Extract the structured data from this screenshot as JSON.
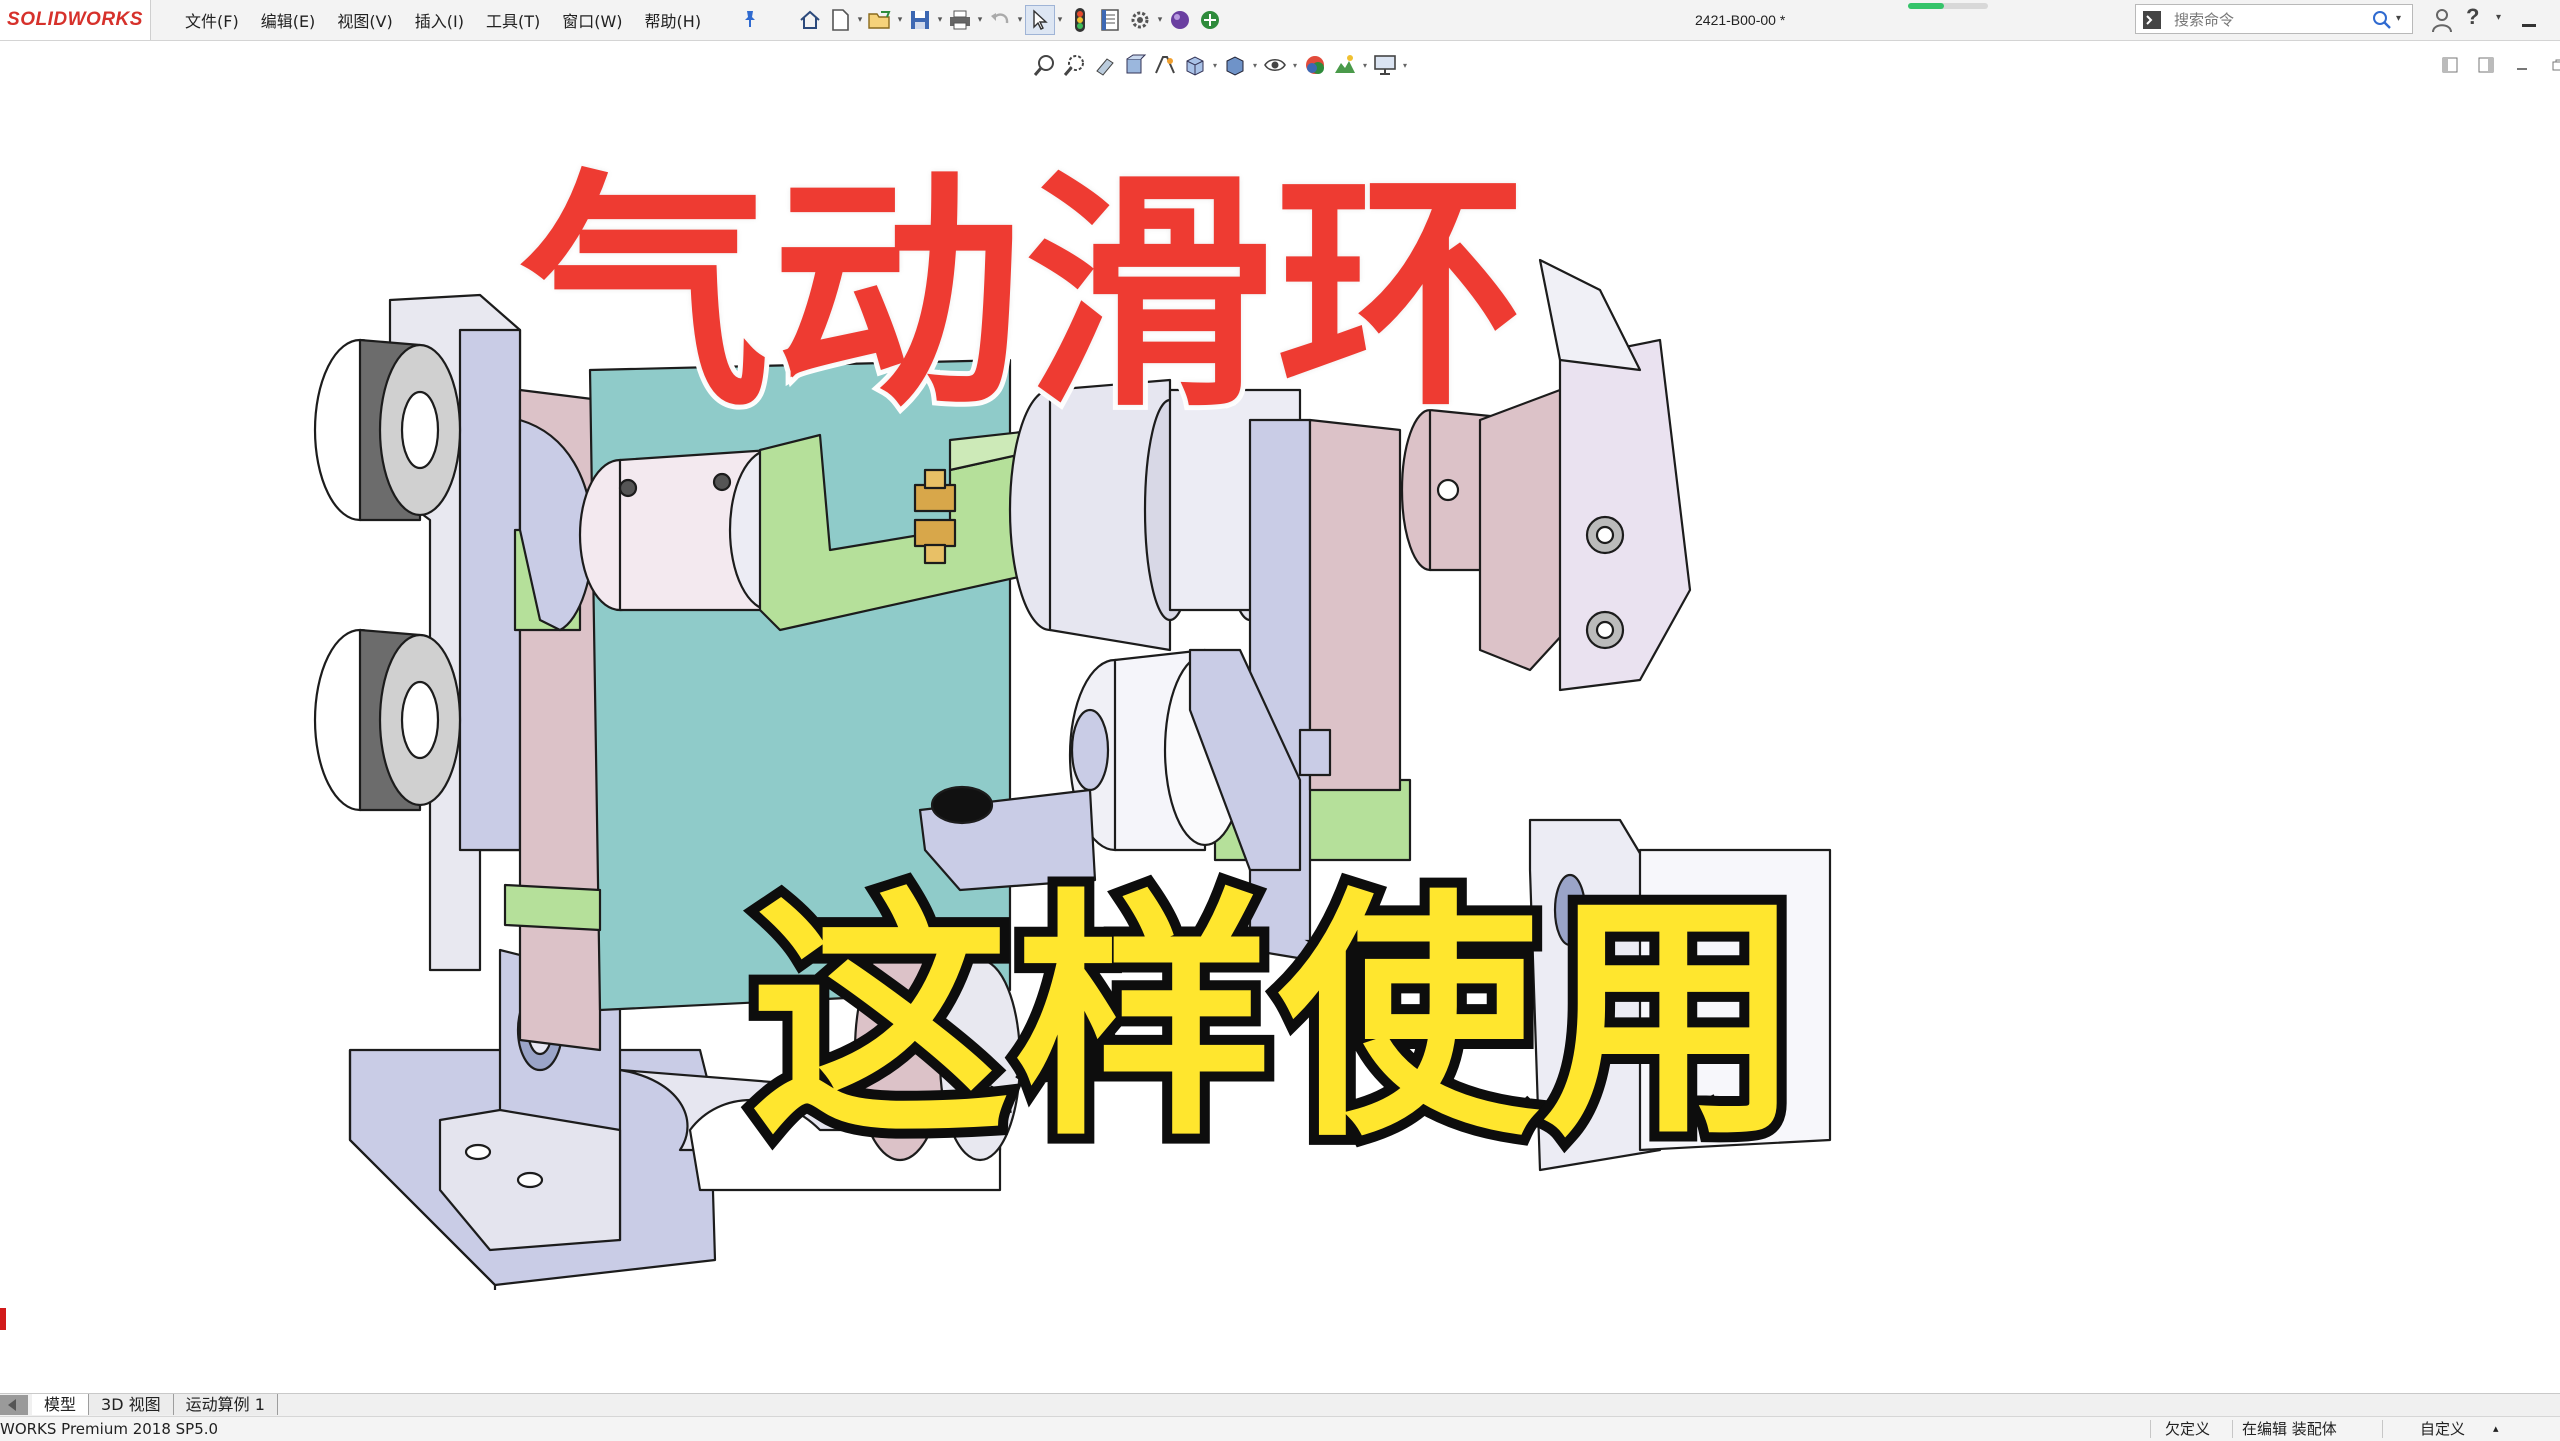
{
  "app": {
    "logo": "SOLIDWORKS",
    "doc_title": "2421-B00-00 *"
  },
  "menu": [
    "文件(F)",
    "编辑(E)",
    "视图(V)",
    "插入(I)",
    "工具(T)",
    "窗口(W)",
    "帮助(H)"
  ],
  "search": {
    "placeholder": "搜索命令"
  },
  "rebuild_progress": 0.45,
  "overlay": {
    "title": "气动滑环",
    "subtitle": "这样使用"
  },
  "tabs": [
    "模型",
    "3D 视图",
    "运动算例 1"
  ],
  "status": {
    "product": "WORKS Premium 2018 SP5.0",
    "underdefined": "欠定义",
    "editing": "在编辑 装配体",
    "custom": "自定义"
  },
  "colors": {
    "title": "#ee3b32",
    "subtitle": "#ffe62e",
    "model_cyan": "#8fcbc9",
    "model_lavender": "#c9cce6",
    "model_pink": "#dcc2c8",
    "model_green": "#b5e09a"
  },
  "icons": [
    "home-icon",
    "new-doc-icon",
    "open-icon",
    "save-icon",
    "print-icon",
    "undo-icon",
    "select-icon",
    "rebuild-icon",
    "file-props-icon",
    "options-icon",
    "appearance-icon"
  ]
}
